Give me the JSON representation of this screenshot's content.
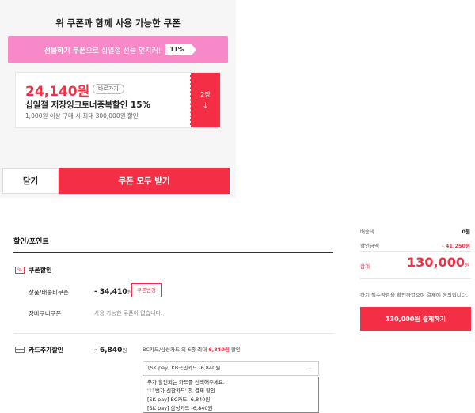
{
  "popup": {
    "title": "위 쿠폰과 함께 사용 가능한 쿠폰",
    "gift_banner": {
      "bold": "선물하기 쿠폰",
      "text": "으로 십일절 선물 앞지커!",
      "badge": "11%"
    },
    "coupon": {
      "price": "24,140원",
      "go_label": "바로가기",
      "name": "십일절 저장잉크토너중복할인 15%",
      "desc": "1,000원 이상 구매 시 최대 300,000원 할인",
      "count": "2장",
      "download_icon": "download-icon"
    },
    "close_label": "닫기",
    "get_all_label": "쿠폰 모두 받기"
  },
  "discount": {
    "title": "할인/포인트",
    "coupon_section": {
      "label": "쿠폰할인",
      "rows": [
        {
          "label": "상품/배송비쿠폰",
          "amount": "- 34,410",
          "unit": "원",
          "button": "쿠폰변경"
        },
        {
          "label": "장바구니쿠폰",
          "note": "사용 가능한 쿠폰이 없습니다."
        }
      ]
    },
    "card_section": {
      "label": "카드추가할인",
      "amount": "- 6,840",
      "unit": "원",
      "note_prefix": "BC카드/삼성카드 외 6종 최대 ",
      "note_highlight": "6,840원",
      "note_suffix": " 할인",
      "selected": "[SK pay] KB국민카드 -6,840원",
      "options": [
        "추가 할인되는 카드를 선택해주세요.",
        "'11번가 신한카드' 첫 결제 할인",
        "[SK pay] BC카드 -6,840원",
        "[SK pay] 삼성카드 -6,840원"
      ]
    }
  },
  "summary": {
    "shipping_label": "배송비",
    "shipping_value": "0원",
    "discount_label": "할인금액",
    "discount_value": "- 41,250원",
    "total_label": "합계",
    "total_value": "130,000",
    "total_unit": "원",
    "agree_text": "하기 필수약관을 확인하였으며 결제에 동의합니다.",
    "pay_label": "130,000원 결제하기"
  },
  "colors": {
    "accent": "#f42f45",
    "gift_banner": "#f889c9"
  }
}
